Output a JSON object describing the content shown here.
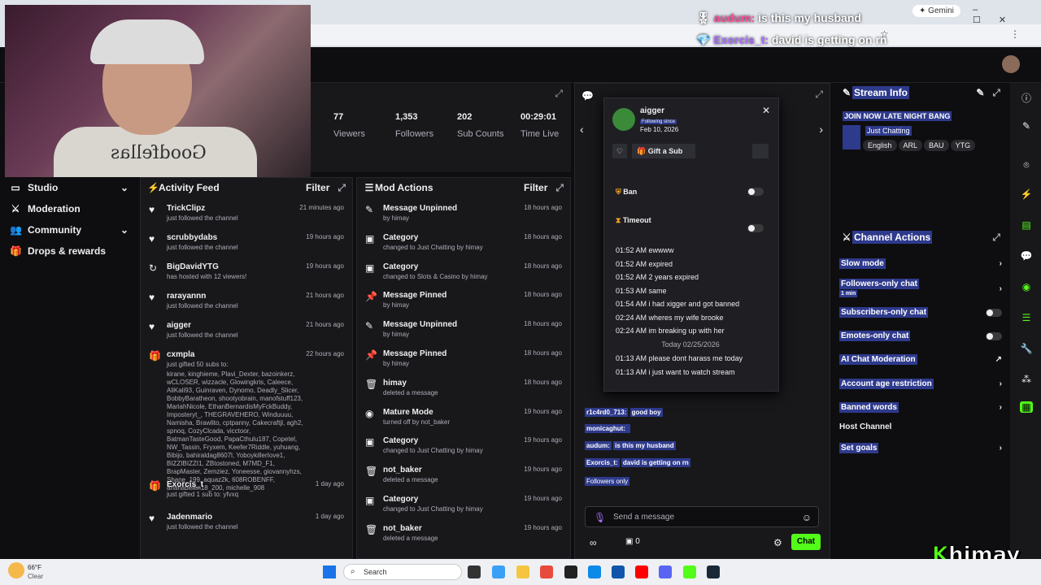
{
  "browser": {
    "gemini": "Gemini"
  },
  "overlay": {
    "line1_user": "audum:",
    "line1_text": "is this my husband",
    "line2_user": "Exorcis_t:",
    "line2_text": "david is getting on rn"
  },
  "leftnav": {
    "items": [
      {
        "label": "Studio"
      },
      {
        "label": "Moderation"
      },
      {
        "label": "Community"
      },
      {
        "label": "Drops & rewards"
      }
    ]
  },
  "stats": [
    {
      "value": "77",
      "label": "Viewers"
    },
    {
      "value": "1,353",
      "label": "Followers"
    },
    {
      "value": "202",
      "label": "Sub Counts"
    },
    {
      "value": "00:29:01",
      "label": "Time Live"
    }
  ],
  "feed": {
    "title": "Activity Feed",
    "filter": "Filter",
    "items": [
      {
        "name": "TrickClipz",
        "desc": "just followed the channel",
        "time": "21 minutes ago",
        "icon": "heart-icon"
      },
      {
        "name": "scrubbydabs",
        "desc": "just followed the channel",
        "time": "19 hours ago",
        "icon": "heart-icon"
      },
      {
        "name": "BigDavidYTG",
        "desc": "has hosted with 12 viewers!",
        "time": "19 hours ago",
        "icon": "host-icon"
      },
      {
        "name": "rarayannn",
        "desc": "just followed the channel",
        "time": "21 hours ago",
        "icon": "heart-icon"
      },
      {
        "name": "aigger",
        "desc": "just followed the channel",
        "time": "21 hours ago",
        "icon": "heart-icon"
      },
      {
        "name": "cxmpla",
        "desc": "just gifted 50 subs to:",
        "time": "22 hours ago",
        "icon": "gift-icon",
        "recipients": "kirane, kinghieme, Plavi_Dexter, bazoinkerz, wCLOSER, wizzacle, Glowingkris, Caleece, AliKali93, Guinraven, Dynomo, Deadly_Slicer, BobbyBaratheon, shootyobrain, manofstuff123, MariahNicole, EthanBernardisMyFckBuddy, Imposteryt_, THEGRAVEHERO, Winduuuu, Namisha, Brawlito, cptpanny, Cakecraftjl, agh2, spnoq, CozyClcada, vicctoor, BatmanTasteGood, PapaCthulu187, Copetel, NW_Tassin, Fryxem, Keefer7Riddle, yuhuang, Bibijo, bahiraldag8607l, YoboykillerIove1, BIZZIBIZZI1, ZBtostoned, M7MD_F1, BrapMaster, Zemziez, Yoneesse, giovannyhzs, Shane_199, aquaz2k, 608ROBENFF, arlanabelen18_200, michelle_908"
      },
      {
        "name": "Exorcis_t",
        "desc": "just gifted 1 sub to: yfvxq",
        "time": "1 day ago",
        "icon": "gift-icon"
      },
      {
        "name": "Jadenmario",
        "desc": "just followed the channel",
        "time": "1 day ago",
        "icon": "heart-icon"
      }
    ]
  },
  "mods": {
    "title": "Mod Actions",
    "filter": "Filter",
    "items": [
      {
        "name": "Message Unpinned",
        "desc": "by himay",
        "time": "18 hours ago"
      },
      {
        "name": "Category",
        "desc": "changed to Just Chatting by himay",
        "time": "18 hours ago"
      },
      {
        "name": "Category",
        "desc": "changed to Slots & Casino by himay",
        "time": "18 hours ago"
      },
      {
        "name": "Message Pinned",
        "desc": "by himay",
        "time": "18 hours ago"
      },
      {
        "name": "Message Unpinned",
        "desc": "by himay",
        "time": "18 hours ago"
      },
      {
        "name": "Message Pinned",
        "desc": "by himay",
        "time": "18 hours ago"
      },
      {
        "name": "himay",
        "desc": "deleted a message",
        "time": "18 hours ago"
      },
      {
        "name": "Mature Mode",
        "desc": "turned off by not_baker",
        "time": "19 hours ago"
      },
      {
        "name": "Category",
        "desc": "changed to Just Chatting by himay",
        "time": "19 hours ago"
      },
      {
        "name": "not_baker",
        "desc": "deleted a message",
        "time": "19 hours ago"
      },
      {
        "name": "Category",
        "desc": "changed to Just Chatting by himay",
        "time": "19 hours ago"
      },
      {
        "name": "not_baker",
        "desc": "deleted a message",
        "time": "19 hours ago"
      }
    ]
  },
  "popup": {
    "username": "aigger",
    "following_since": "Following since",
    "date": "Feb 10, 2026",
    "gift": "Gift a Sub",
    "ban": "Ban",
    "timeout": "Timeout",
    "messages": [
      "01:52 AM ewwww",
      "01:52 AM expired",
      "01:52 AM 2 years expired",
      "01:53 AM same",
      "01:54 AM i had xigger and got banned",
      "02:24 AM wheres my wife brooke",
      "02:24 AM im breaking up with her"
    ],
    "today": "Today 02/25/2026",
    "messages2": [
      "01:13 AM please dont harass me today",
      "01:13 AM i just want to watch stream"
    ]
  },
  "chat": {
    "lines": [
      {
        "user": "r1c4rd0_713:",
        "text": "good boy"
      },
      {
        "user": "monicaghut:",
        "text": ""
      },
      {
        "user": "audum:",
        "text": "is this my husband"
      },
      {
        "user": "Exorcis_t:",
        "text": "david is getting on rn"
      }
    ],
    "followers_only": "Followers only",
    "placeholder": "Send a message",
    "count": "0",
    "send": "Chat"
  },
  "streaminfo": {
    "title": "Stream Info",
    "stream_title": "JOIN NOW LATE NIGHT BANG",
    "category": "Just Chatting",
    "tags": [
      "English",
      "ARL",
      "BAU",
      "YTG"
    ]
  },
  "chanact": {
    "title": "Channel Actions",
    "items": [
      "Slow mode",
      "Followers-only chat",
      "Subscribers-only chat",
      "Emotes-only chat",
      "AI Chat Moderation",
      "Account age restriction",
      "Banned words",
      "Host Channel",
      "Set goals"
    ],
    "followers_sub": "1 min"
  },
  "taskbar": {
    "weather_temp": "66°F",
    "weather_desc": "Clear",
    "search": "Search"
  },
  "brand": {
    "name": "himay"
  },
  "colors": {
    "accent": "#00f593",
    "brand": "#53fc18",
    "highlight": "#2e3a8c"
  }
}
